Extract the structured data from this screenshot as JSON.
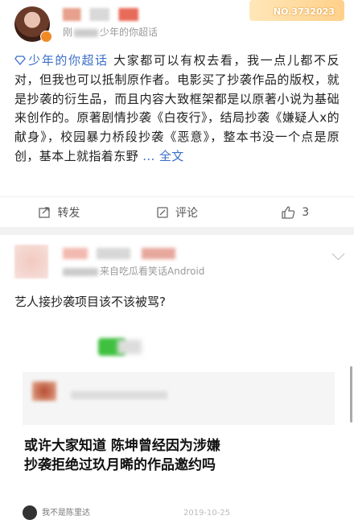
{
  "post1": {
    "medal_text": "NO.3732023",
    "via_prefix": "刚",
    "via_topic": "少年的你超话",
    "topic_tag": "少年的你超话",
    "body": "大家都可以有权去看，我一点儿都不反对，但我也可以抵制原作者。电影买了抄袭作品的版权，就是抄袭的衍生品，而且内容大致框架都是以原著小说为基础来创作的。原著剧情抄袭《白夜行》，结局抄袭《嫌疑人x的献身》，校园暴力桥段抄袭《恶意》，整本书没一个点是原创，基本上就指着东野",
    "more": "... 全文",
    "actions": {
      "repost": "转发",
      "comment": "评论",
      "like_count": "3"
    }
  },
  "post2": {
    "via_suffix": "来自吃瓜看笑话Android",
    "text": "艺人接抄袭项目该不该被骂?",
    "headline": "或许大家知道 陈坤曾经因为涉嫌抄袭拒绝过玖月晞的作品邀约吗",
    "footer_name": "我不是陈里达",
    "footer_date": "2019-10-25"
  }
}
